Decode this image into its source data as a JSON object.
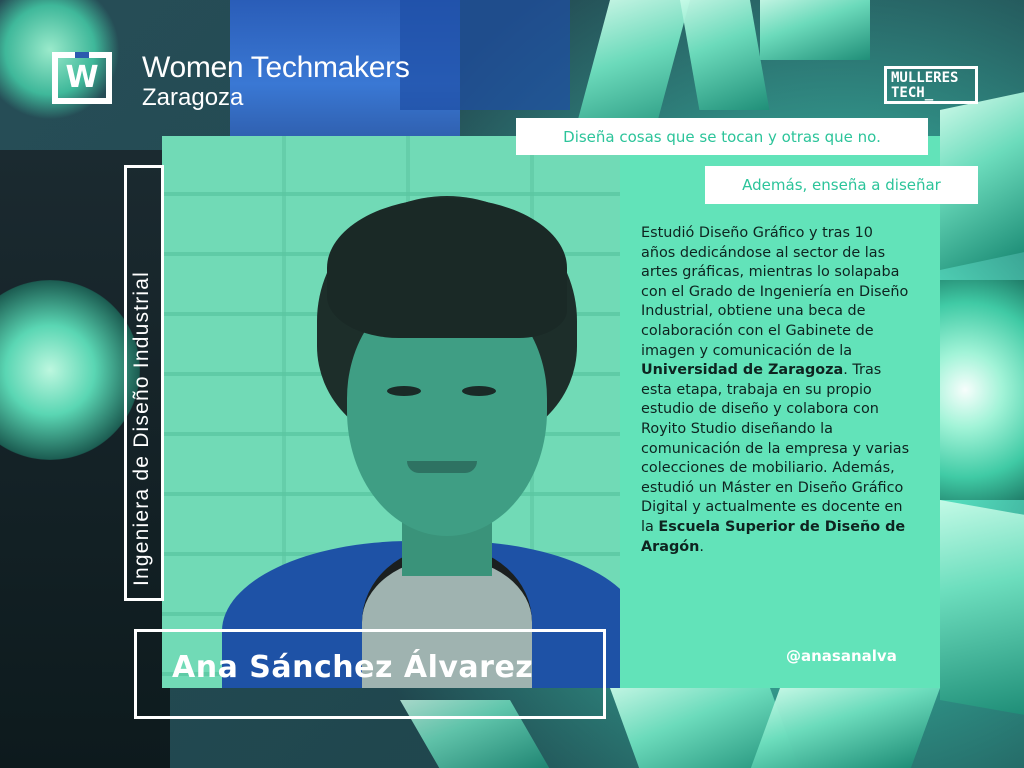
{
  "brand": {
    "logo_letter": "W",
    "title": "Women Techmakers",
    "subtitle": "Zaragoza",
    "partner_line1": "MULLERES",
    "partner_line2": "TECH_"
  },
  "profile": {
    "role_vertical": "Ingeniera de Diseño Industrial",
    "tagline_1": "Diseña cosas que se tocan y otras que no.",
    "tagline_2": "Además, enseña a diseñar",
    "bio_1": "Estudió Diseño Gráfico y tras 10 años dedicándose al sector de las artes gráficas, mientras lo solapaba con el Grado de Ingeniería en Diseño Industrial, obtiene una beca de colaboración con el Gabinete de imagen y comunicación de la ",
    "bio_bold_1": "Universidad de Zaragoza",
    "bio_2": ". Tras esta etapa, trabaja en su propio estudio de diseño y colabora con Royito Studio diseñando la comunicación de la empresa y varias colecciones de mobiliario. Además, estudió un Máster en Diseño Gráfico Digital y actualmente es docente en la ",
    "bio_bold_2": "Escuela Superior de Diseño de Aragón",
    "bio_3": ".",
    "handle": "@anasanalva",
    "name": "Ana Sánchez Álvarez"
  },
  "colors": {
    "accent": "#62e3b9",
    "tag_text": "#2cc49a",
    "white": "#ffffff"
  }
}
